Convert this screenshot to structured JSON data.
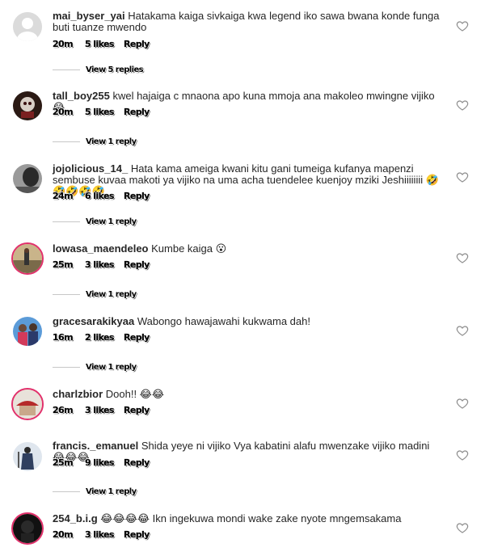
{
  "comments": [
    {
      "user": "mai_byser_yai",
      "text": "Hatakama kaiga sivkaiga kwa legend iko sawa bwana konde funga buti tuanze mwendo",
      "time": "20m",
      "likes": "5 likes",
      "reply": "Reply",
      "view_replies": "View 5 replies",
      "avatar": "default-avatar"
    },
    {
      "user": "tall_boy255",
      "text": "kwel hajaiga c mnaona apo kuna mmoja ana makoleo mwingne vijiko😂",
      "time": "20m",
      "likes": "5 likes",
      "reply": "Reply",
      "view_replies": "View 1 reply",
      "avatar": "skull-avatar"
    },
    {
      "user": "jojolicious_14_",
      "text": "Hata kama ameiga kwani kitu gani tumeiga kufanya mapenzi sembuse kuvaa makoti ya vijiko na uma acha tuendelee kuenjoy mziki Jeshiiiiiiii 🤣🤣🤣🤣🤣",
      "time": "24m",
      "likes": "6 likes",
      "reply": "Reply",
      "view_replies": "View 1 reply",
      "avatar": "portrait-avatar"
    },
    {
      "user": "lowasa_maendeleo",
      "text": "Kumbe kaiga 😮",
      "time": "25m",
      "likes": "3 likes",
      "reply": "Reply",
      "view_replies": "View 1 reply",
      "avatar": "street-avatar"
    },
    {
      "user": "gracesarakikyaa",
      "text": "Wabongo hawajawahi kukwama dah!",
      "time": "16m",
      "likes": "2 likes",
      "reply": "Reply",
      "view_replies": "View 1 reply",
      "avatar": "group-avatar"
    },
    {
      "user": "charlzbior",
      "text": "Dooh!! 😂😂",
      "time": "26m",
      "likes": "3 likes",
      "reply": "Reply",
      "view_replies": "",
      "avatar": "hat-avatar"
    },
    {
      "user": "francis._emanuel",
      "text": "Shida yeye ni vijiko Vya kabatini alafu mwenzake vijiko madini😂😂😂",
      "time": "25m",
      "likes": "9 likes",
      "reply": "Reply",
      "view_replies": "View 1 reply",
      "avatar": "figure-avatar"
    },
    {
      "user": "254_b.i.g",
      "text": "😂😂😂😂 Ikn ingekuwa mondi wake zake nyote mngemsakama",
      "time": "20m",
      "likes": "3 likes",
      "reply": "Reply",
      "view_replies": "",
      "avatar": "dark-avatar"
    }
  ],
  "colors": {
    "text": "#262626",
    "line": "#c7c7c7",
    "heart": "#8e8e8e",
    "story_ring": "#e1306c"
  }
}
